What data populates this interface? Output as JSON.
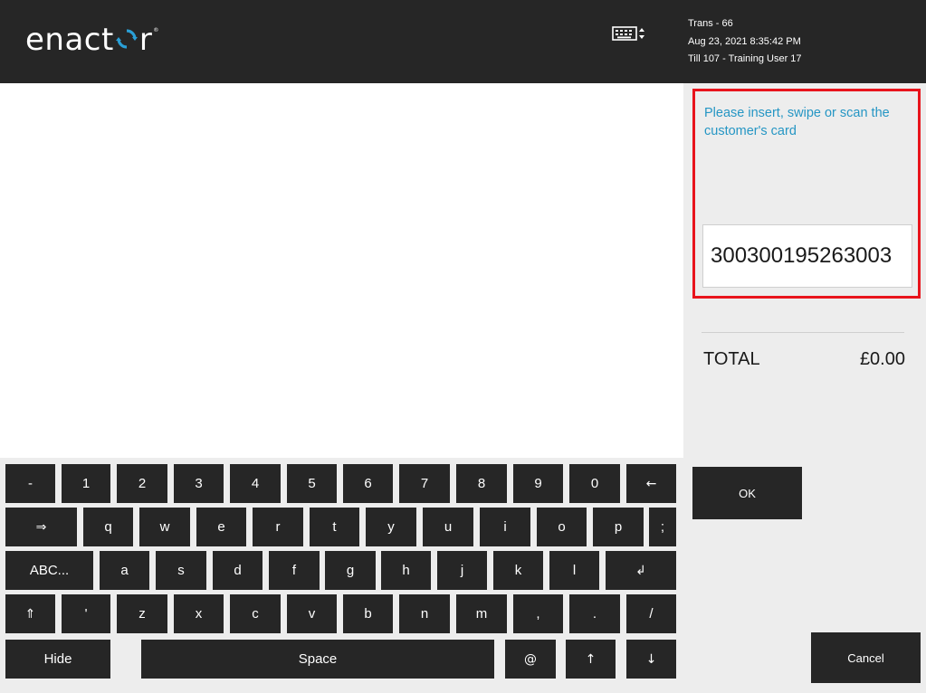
{
  "header": {
    "logo_text_pre": "enact",
    "logo_text_post": "r",
    "logo_mark_icon": "circular-arrows-icon",
    "keyboard_toggle_icon": "keyboard-icon",
    "trans": "Trans - 66",
    "datetime": "Aug 23, 2021 8:35:42 PM",
    "till": "Till 107 - Training User 17",
    "brand_accent": "#2a9fd6"
  },
  "prompt": {
    "message": "Please insert, swipe or scan the customer's card",
    "card_value": "300300195263003",
    "highlight_color": "#e8141c",
    "text_color": "#2596c4"
  },
  "totals": {
    "label": "TOTAL",
    "value": "£0.00"
  },
  "buttons": {
    "ok": "OK",
    "cancel": "Cancel"
  },
  "keyboard": {
    "row1": [
      "-",
      "1",
      "2",
      "3",
      "4",
      "5",
      "6",
      "7",
      "8",
      "9",
      "0",
      "←"
    ],
    "row2": [
      "⇒",
      "q",
      "w",
      "e",
      "r",
      "t",
      "y",
      "u",
      "i",
      "o",
      "p",
      ";"
    ],
    "row3": [
      "ABC...",
      "a",
      "s",
      "d",
      "f",
      "g",
      "h",
      "j",
      "k",
      "l",
      "↲"
    ],
    "row4": [
      "⇑",
      "'",
      "z",
      "x",
      "c",
      "v",
      "b",
      "n",
      "m",
      ",",
      ".",
      "/"
    ],
    "row5": [
      "Hide",
      "Space",
      "@",
      "↑",
      "↓"
    ]
  }
}
